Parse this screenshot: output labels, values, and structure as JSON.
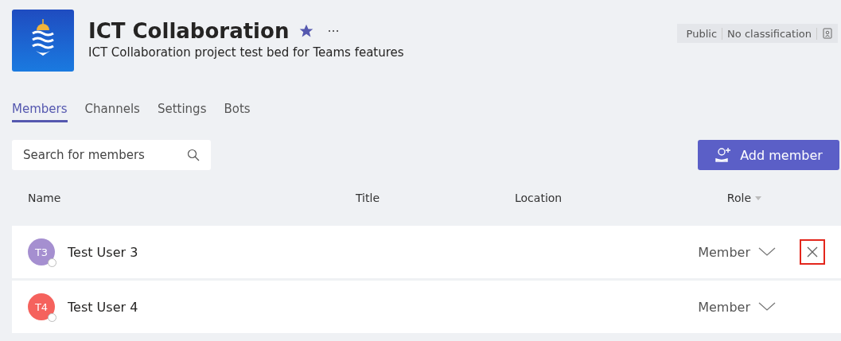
{
  "team": {
    "title": "ICT Collaboration",
    "favorite": true,
    "more": "···",
    "description": "ICT Collaboration project test bed for Teams features"
  },
  "badges": [
    "Public",
    "No classification"
  ],
  "tabs": [
    {
      "label": "Members",
      "selected": true
    },
    {
      "label": "Channels",
      "selected": false
    },
    {
      "label": "Settings",
      "selected": false
    },
    {
      "label": "Bots",
      "selected": false
    }
  ],
  "search": {
    "placeholder": "Search for members"
  },
  "add_button": "Add member",
  "table": {
    "columns": [
      "Name",
      "Title",
      "Location",
      "Role"
    ],
    "rows": [
      {
        "initials": "T3",
        "color": "#a58fd0",
        "name": "Test User 3",
        "role": "Member",
        "remove": true,
        "highlighted": true
      },
      {
        "initials": "T4",
        "color": "#f5625d",
        "name": "Test User 4",
        "role": "Member",
        "remove": false
      }
    ]
  }
}
